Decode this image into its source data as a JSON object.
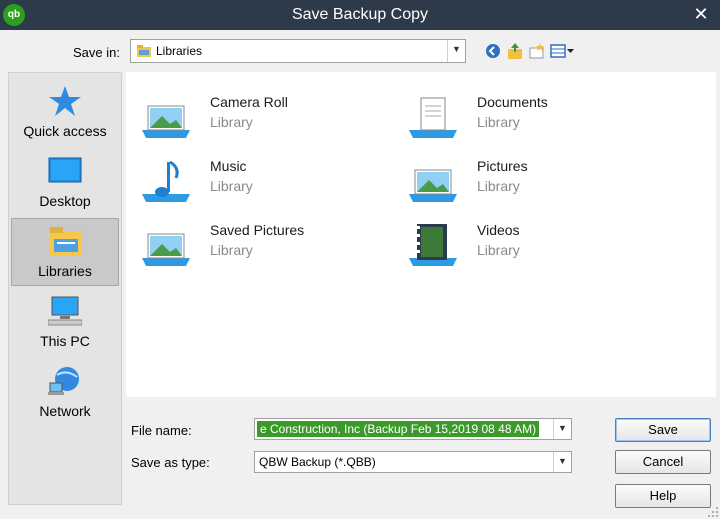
{
  "window": {
    "title": "Save Backup Copy",
    "app_logo": "qb",
    "close_label": "✕"
  },
  "toolbar": {
    "save_in_label": "Save in:",
    "save_in_value": "Libraries",
    "icons": [
      "back-icon",
      "up-folder-icon",
      "new-folder-icon",
      "view-menu-icon"
    ]
  },
  "places": [
    {
      "label": "Quick access",
      "icon": "star-icon",
      "selected": false
    },
    {
      "label": "Desktop",
      "icon": "desktop-icon",
      "selected": false
    },
    {
      "label": "Libraries",
      "icon": "libraries-icon",
      "selected": true
    },
    {
      "label": "This PC",
      "icon": "computer-icon",
      "selected": false
    },
    {
      "label": "Network",
      "icon": "network-icon",
      "selected": false
    }
  ],
  "items": [
    {
      "name": "Camera Roll",
      "type": "Library",
      "icon": "picture-library-icon"
    },
    {
      "name": "Documents",
      "type": "Library",
      "icon": "documents-library-icon"
    },
    {
      "name": "Music",
      "type": "Library",
      "icon": "music-library-icon"
    },
    {
      "name": "Pictures",
      "type": "Library",
      "icon": "picture-library-icon"
    },
    {
      "name": "Saved Pictures",
      "type": "Library",
      "icon": "picture-library-icon"
    },
    {
      "name": "Videos",
      "type": "Library",
      "icon": "videos-library-icon"
    }
  ],
  "form": {
    "filename_label": "File name:",
    "filename_value": "e Construction, Inc (Backup Feb 15,2019  08 48 AM)",
    "savetype_label": "Save as type:",
    "savetype_value": "QBW Backup (*.QBB)"
  },
  "buttons": {
    "save": "Save",
    "cancel": "Cancel",
    "help": "Help"
  },
  "colors": {
    "titlebar": "#2c3a4a",
    "selection_green": "#3a9a2a",
    "selected_place": "#c9c9c9"
  }
}
